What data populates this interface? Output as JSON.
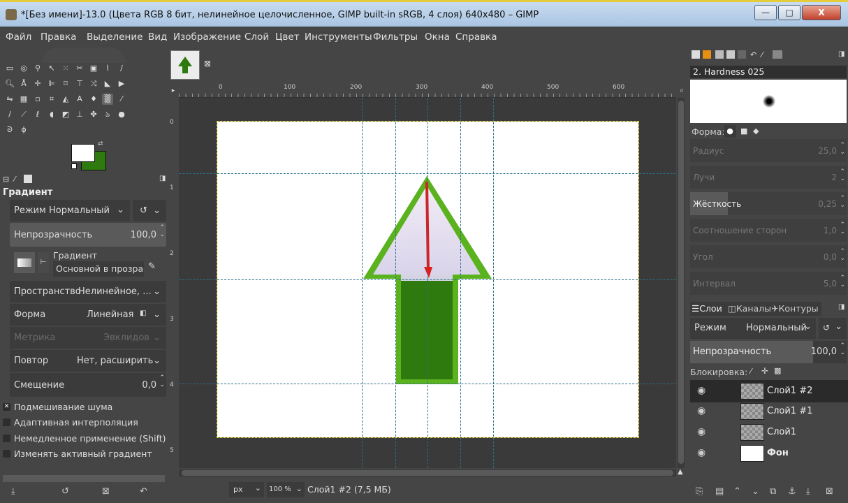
{
  "window": {
    "title": "*[Без имени]-13.0 (Цвета RGB 8 бит, нелинейное целочисленное, GIMP built-in sRGB, 4 слоя) 640x480 – GIMP",
    "minimize": "—",
    "maximize": "□",
    "close": "X"
  },
  "menu": [
    "Файл",
    "Правка",
    "Выделение",
    "Вид",
    "Изображение",
    "Слой",
    "Цвет",
    "Инструменты",
    "Фильтры",
    "Окна",
    "Справка"
  ],
  "colors": {
    "foreground": "#ffffff",
    "background": "#2e7a0e",
    "guide": "#2a6f8a",
    "arrow_fill": "#2e7a0e",
    "arrow_border": "#5ab21e",
    "drag_line": "#e31b1b"
  },
  "tool_options": {
    "title": "Градиент",
    "mode_label": "Режим",
    "mode_value": "Нормальный",
    "opacity_label": "Непрозрачность",
    "opacity_value": "100,0",
    "gradient_label": "Градиент",
    "gradient_value": "Основной в прозрач",
    "space_label": "Пространство",
    "space_value": "Нелинейное, ...",
    "shape_label": "Форма",
    "shape_value": "Линейная",
    "metric_label": "Метрика",
    "metric_value": "Эвклидов",
    "repeat_label": "Повтор",
    "repeat_value": "Нет, расширить",
    "offset_label": "Смещение",
    "offset_value": "0,0",
    "options": [
      {
        "label": "Подмешивание шума",
        "checked": true
      },
      {
        "label": "Адаптивная интерполяция",
        "checked": false
      },
      {
        "label": "Немедленное применение (Shift)",
        "checked": false
      },
      {
        "label": "Изменять активный градиент",
        "checked": false
      }
    ]
  },
  "ruler": {
    "marks": [
      "0",
      "100",
      "200",
      "300",
      "400",
      "500",
      "600"
    ],
    "v_marks": [
      "1",
      "2",
      "3",
      "4",
      "5"
    ]
  },
  "status": {
    "unit": "px",
    "zoom": "100 %",
    "layer_info": "Слой1 #2 (7,5 МБ)"
  },
  "brushes": {
    "name": "2. Hardness 025",
    "shape_label": "Форма:",
    "params": [
      {
        "label": "Радиус",
        "value": "25,0"
      },
      {
        "label": "Лучи",
        "value": "2"
      },
      {
        "label": "Жёсткость",
        "value": "0,25"
      },
      {
        "label": "Соотношение сторон",
        "value": "1,0"
      },
      {
        "label": "Угол",
        "value": "0,0"
      },
      {
        "label": "Интервал",
        "value": "5,0"
      }
    ]
  },
  "layers_panel": {
    "tabs": [
      "Слои",
      "Каналы",
      "Контуры"
    ],
    "mode_label": "Режим",
    "mode_value": "Нормальный",
    "opacity_label": "Непрозрачность",
    "opacity_value": "100,0",
    "lock_label": "Блокировка:",
    "layers": [
      {
        "name": "Слой1 #2",
        "active": true
      },
      {
        "name": "Слой1 #1",
        "active": false
      },
      {
        "name": "Слой1",
        "active": false
      },
      {
        "name": "Фон",
        "active": false
      }
    ]
  },
  "canvas_tab": {
    "close": "⊠"
  }
}
